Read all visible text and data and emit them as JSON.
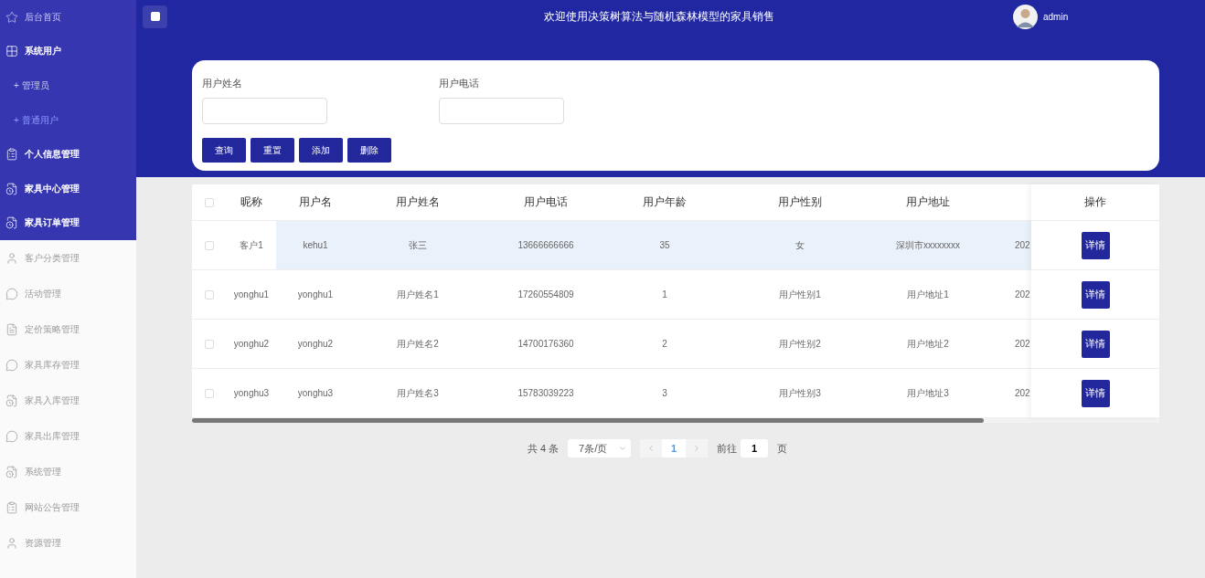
{
  "header": {
    "title": "欢迎使用决策树算法与随机森林模型的家具销售",
    "user": "admin"
  },
  "sidebar": {
    "primary_menu": [
      {
        "label": "后台首页",
        "selected": false
      },
      {
        "label": "系统用户",
        "selected": false,
        "expanded": true,
        "children": [
          {
            "label": "+ 管理员",
            "selected": false
          },
          {
            "label": "+ 普通用户",
            "selected": true
          }
        ]
      },
      {
        "label": "个人信息管理",
        "selected": false
      },
      {
        "label": "家具中心管理",
        "selected": false
      },
      {
        "label": "家具订单管理",
        "selected": false
      }
    ],
    "secondary_menu": [
      {
        "label": "客户分类管理",
        "selected": false
      },
      {
        "label": "活动管理",
        "selected": false
      },
      {
        "label": "定价策略管理",
        "selected": false
      },
      {
        "label": "家具库存管理",
        "selected": false
      },
      {
        "label": "家具入库管理",
        "selected": false
      },
      {
        "label": "家具出库管理",
        "selected": false
      },
      {
        "label": "系统管理",
        "selected": false
      },
      {
        "label": "网站公告管理",
        "selected": false
      },
      {
        "label": "资源管理",
        "selected": false
      }
    ]
  },
  "search": {
    "fields": [
      {
        "label": "用户姓名"
      },
      {
        "label": "用户电话"
      }
    ],
    "buttons": [
      "查询",
      "重置",
      "添加",
      "删除"
    ]
  },
  "table": {
    "all_checked": false,
    "columns": [
      "昵称",
      "用户名",
      "用户姓名",
      "用户电话",
      "用户年龄",
      "用户性别",
      "用户地址"
    ],
    "action_column": "操作",
    "rows": [
      {
        "checked": false,
        "selected": true,
        "cells": [
          "客户1",
          "kehu1",
          "张三",
          "13666666666",
          "35",
          "女",
          "深圳市xxxxxxxx",
          "202"
        ],
        "action": "详情"
      },
      {
        "checked": false,
        "selected": false,
        "cells": [
          "yonghu1",
          "yonghu1",
          "用户姓名1",
          "17260554809",
          "1",
          "用户性别1",
          "用户地址1",
          "202"
        ],
        "action": "详情"
      },
      {
        "checked": false,
        "selected": false,
        "cells": [
          "yonghu2",
          "yonghu2",
          "用户姓名2",
          "14700176360",
          "2",
          "用户性别2",
          "用户地址2",
          "202"
        ],
        "action": "详情"
      },
      {
        "checked": false,
        "selected": false,
        "cells": [
          "yonghu3",
          "yonghu3",
          "用户姓名3",
          "15783039223",
          "3",
          "用户性别3",
          "用户地址3",
          "202"
        ],
        "action": "详情"
      }
    ]
  },
  "pagination": {
    "total": "共 4 条",
    "page_size": "7条/页",
    "pages": [
      {
        "label": "1",
        "selected": true
      }
    ],
    "goto_label": "前往",
    "goto_value": "1",
    "goto_suffix": "页"
  }
}
